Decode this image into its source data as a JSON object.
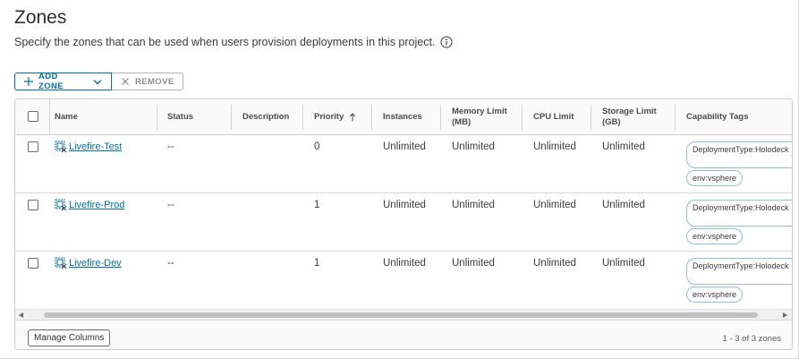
{
  "page": {
    "title": "Zones",
    "description": "Specify the zones that can be used when users provision deployments in this project."
  },
  "toolbar": {
    "add_label": "ADD ZONE",
    "remove_label": "REMOVE"
  },
  "table": {
    "columns": [
      "Name",
      "Status",
      "Description",
      "Priority",
      "Instances",
      "Memory Limit (MB)",
      "CPU Limit",
      "Storage Limit (GB)",
      "Capability Tags"
    ],
    "sort_column": "Priority",
    "rows": [
      {
        "name": "Livefire-Test",
        "status": "--",
        "description": "",
        "priority": "0",
        "instances": "Unlimited",
        "memory": "Unlimited",
        "cpu": "Unlimited",
        "storage": "Unlimited",
        "tags": [
          "DeploymentType:Holodeck",
          "env:vsphere"
        ]
      },
      {
        "name": "Livefire-Prod",
        "status": "--",
        "description": "",
        "priority": "1",
        "instances": "Unlimited",
        "memory": "Unlimited",
        "cpu": "Unlimited",
        "storage": "Unlimited",
        "tags": [
          "DeploymentType:Holodeck",
          "env:vsphere"
        ]
      },
      {
        "name": "Livefire-Dev",
        "status": "--",
        "description": "",
        "priority": "1",
        "instances": "Unlimited",
        "memory": "Unlimited",
        "cpu": "Unlimited",
        "storage": "Unlimited",
        "tags": [
          "DeploymentType:Holodeck",
          "env:vsphere"
        ]
      }
    ]
  },
  "footer": {
    "manage_columns_label": "Manage Columns",
    "pagination": "1 - 3 of 3 zones"
  },
  "colors": {
    "accent": "#0072a3",
    "border": "#cccccc"
  }
}
